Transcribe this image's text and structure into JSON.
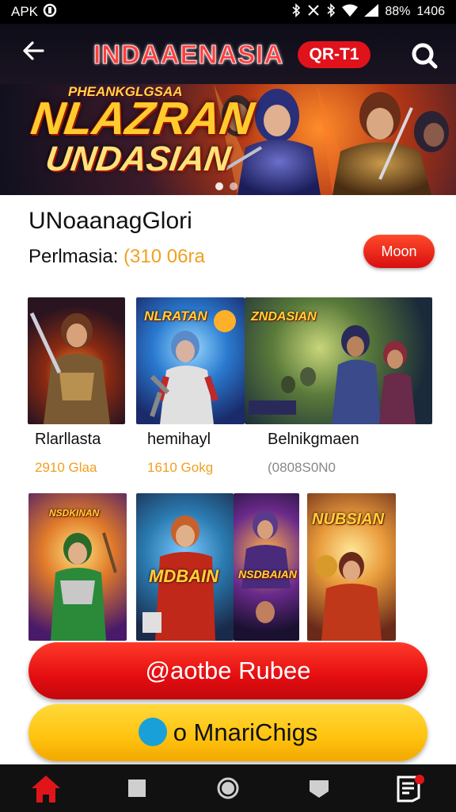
{
  "status_bar": {
    "left_text": "APK",
    "time": "1406",
    "battery": "88%"
  },
  "header": {
    "title": "INDAAENASIA",
    "badge": "QR-T1",
    "back_icon": "arrow-left-icon",
    "search_icon": "search-icon"
  },
  "hero": {
    "subtitle": "PHEANKGLGSAA",
    "title_line1": "NLAZRAN",
    "title_line2": "UNDASIAN",
    "active_slide": 1,
    "slide_count": 2
  },
  "info": {
    "game_name": "UNoaanagGlori",
    "price_label": "Perlmasia:",
    "price_value": "(310 06ra",
    "more_button": "Moon"
  },
  "cards_row1": [
    {
      "name": "Rlarllasta",
      "price": "2910 Glaa",
      "art_title": ""
    },
    {
      "name": "hemihayl",
      "price": "1610 Gokg",
      "art_title": "NLRATAN"
    },
    {
      "name": "Belnikgmaen",
      "price": "(0808S0N0",
      "art_title": "ZNDASIAN"
    }
  ],
  "cards_row2": [
    {
      "art_title": "NSDKINAN"
    },
    {
      "art_title": "MDBAIN"
    },
    {
      "art_title": "NSDBAIAN"
    },
    {
      "art_title": "NUBSIAN"
    }
  ],
  "actions": {
    "primary": "@aotbe Rubee",
    "secondary": "o MnariChigs"
  },
  "nav": {
    "items": [
      "home-icon",
      "square-icon",
      "circle-icon",
      "back-triangle-icon",
      "notes-icon"
    ]
  },
  "colors": {
    "accent_red": "#e0121c",
    "accent_yellow": "#ffc20e",
    "price_orange": "#f0a020"
  }
}
